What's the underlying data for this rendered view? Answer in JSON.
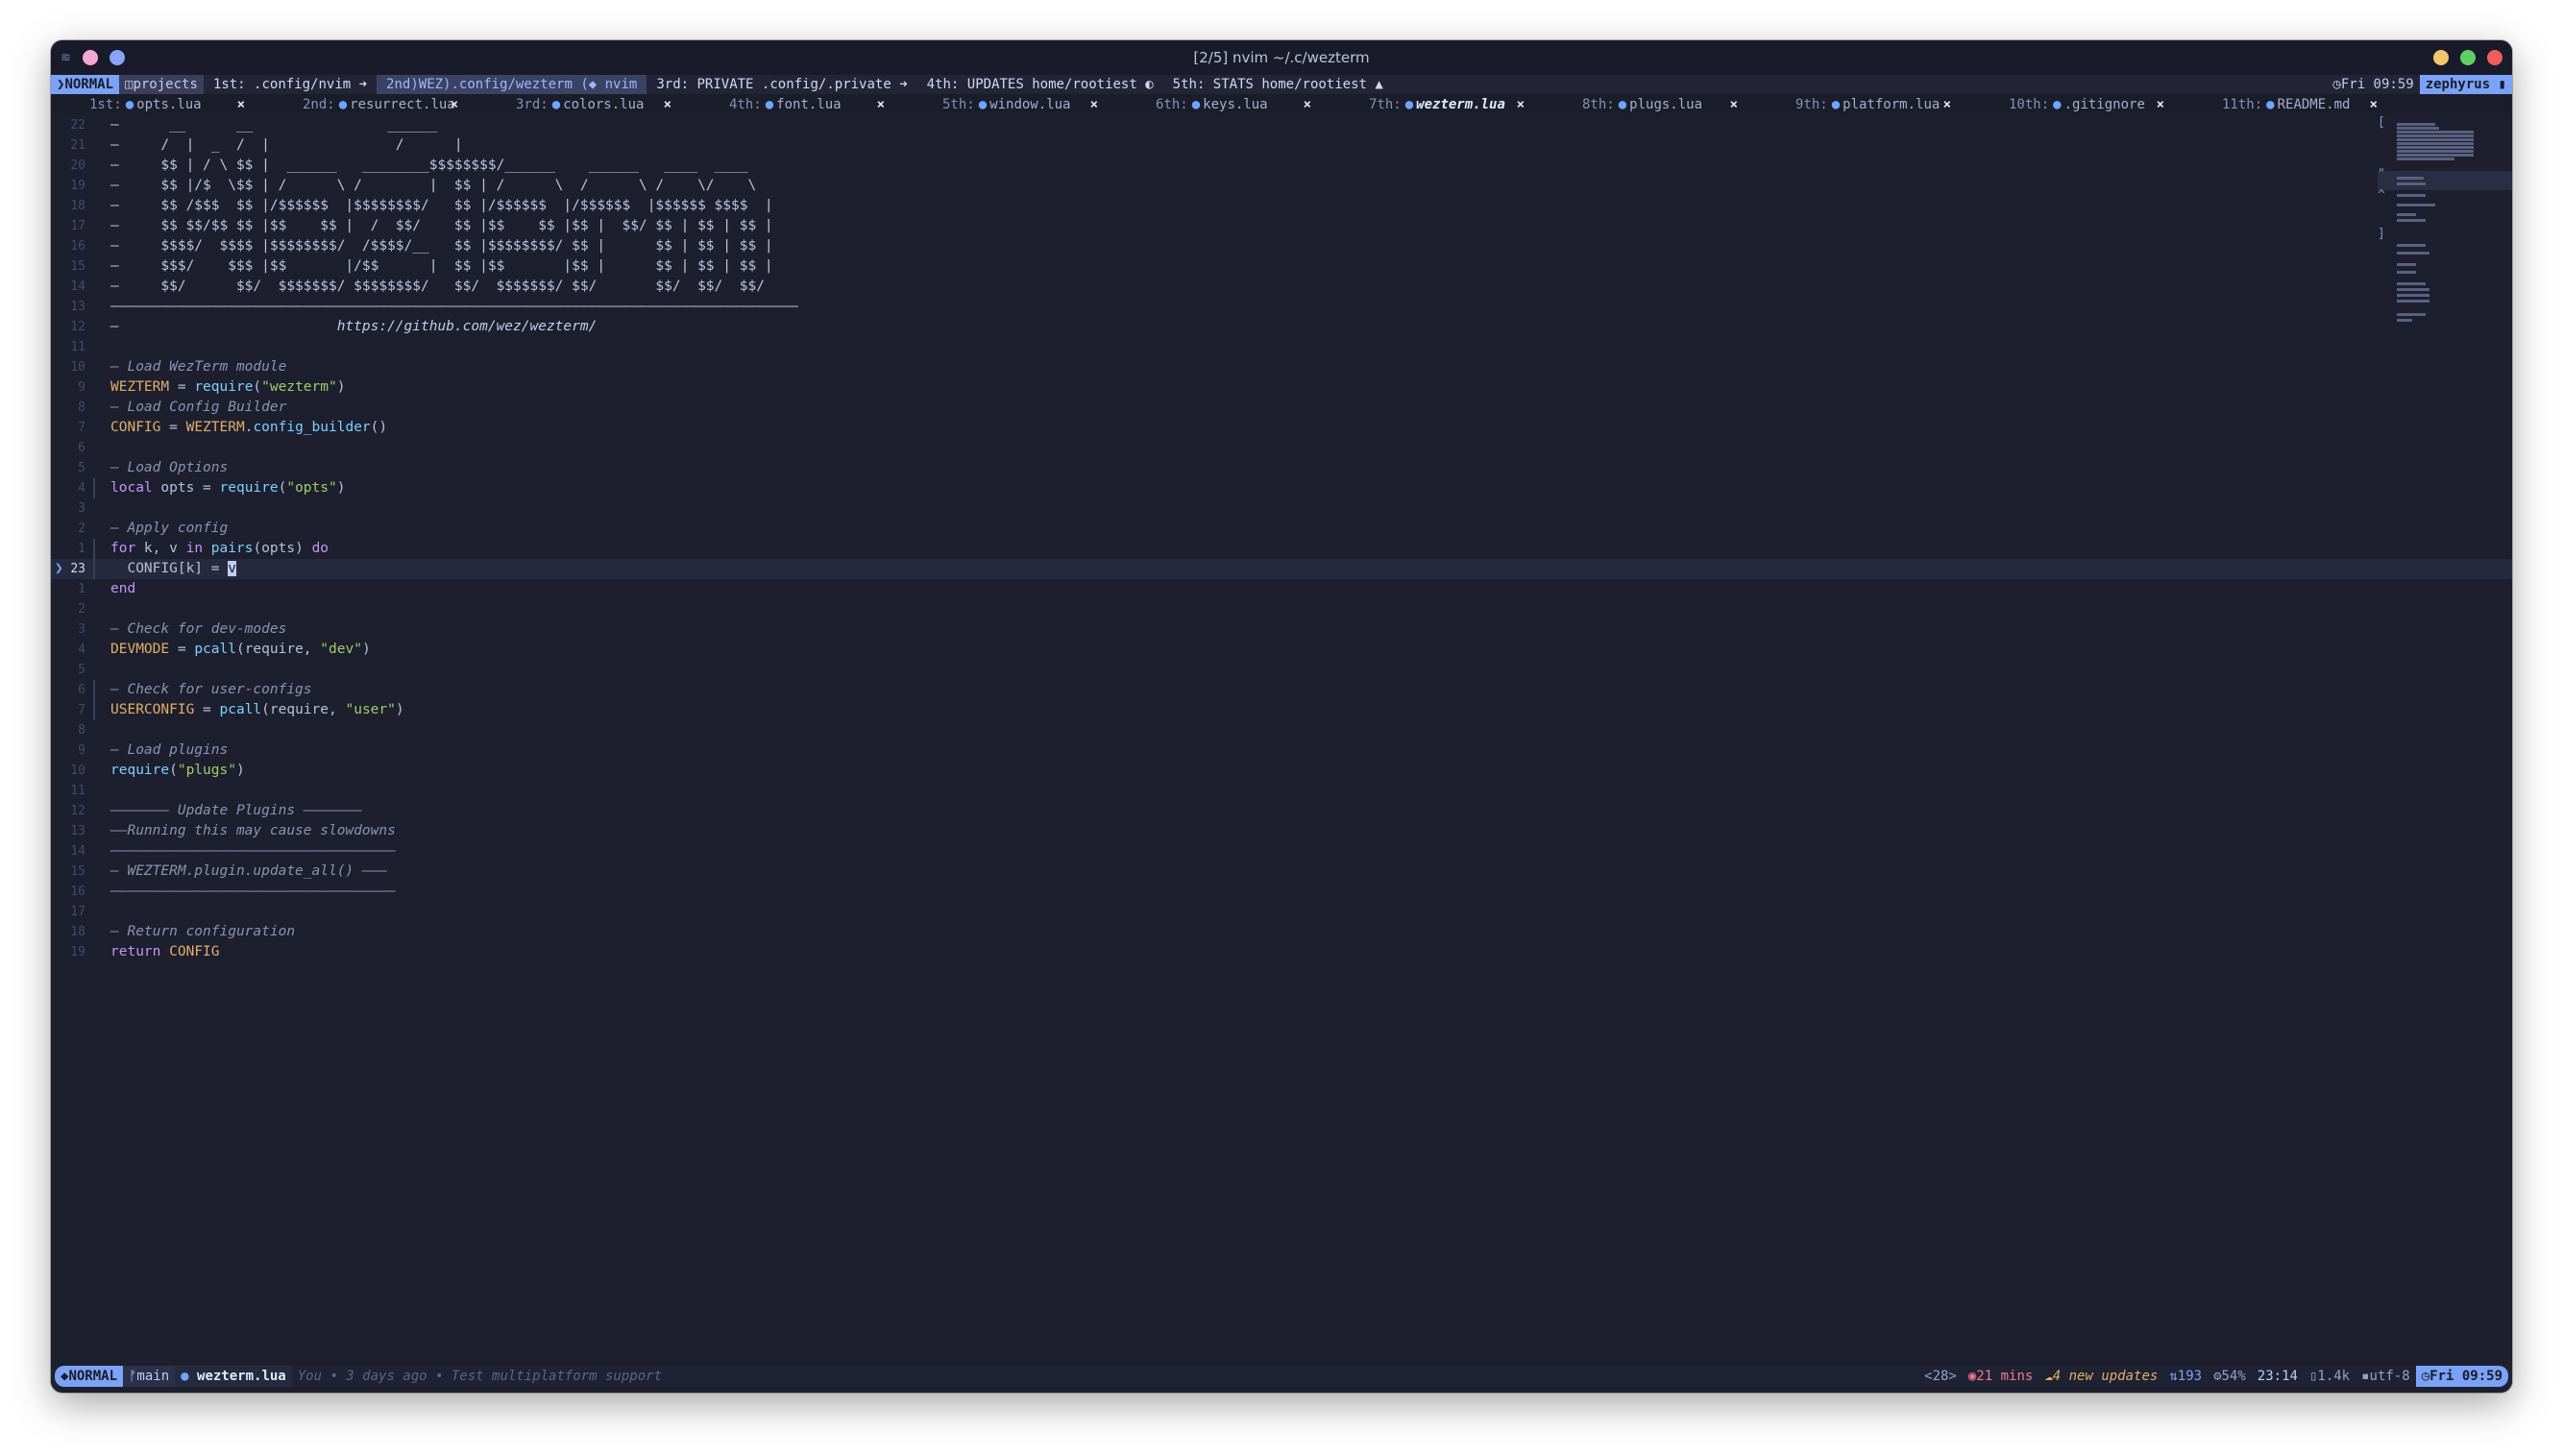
{
  "window": {
    "title": "[2/5] nvim ~/.c/wezterm",
    "left_icon": "≋",
    "traffic": {
      "yellow": "#f4c66b",
      "green": "#5fcf65",
      "red": "#ee5f5b",
      "pink": "#f4a7d3",
      "blue": "#8aa4f8"
    }
  },
  "wezbar": {
    "mode": "NORMAL",
    "project": "projects",
    "tabs": [
      {
        "label": "1st: .config/nvim ➜"
      },
      {
        "label": "2nd)WEZ).config/wezterm (◆ nvim"
      },
      {
        "label": "3rd: PRIVATE .config/.private ➜"
      },
      {
        "label": "4th: UPDATES home/rootiest ◐"
      },
      {
        "label": "5th: STATS home/rootiest ▲"
      }
    ],
    "clock": "Fri 09:59",
    "host": "zephyrus"
  },
  "buffers": [
    {
      "ord": "1st:",
      "name": "opts.lua",
      "close": "×"
    },
    {
      "ord": "2nd:",
      "name": "resurrect.lua",
      "close": "×"
    },
    {
      "ord": "3rd:",
      "name": "colors.lua",
      "close": "×"
    },
    {
      "ord": "4th:",
      "name": "font.lua",
      "close": "×"
    },
    {
      "ord": "5th:",
      "name": "window.lua",
      "close": "×"
    },
    {
      "ord": "6th:",
      "name": "keys.lua",
      "close": "×"
    },
    {
      "ord": "7th:",
      "name": "wezterm.lua",
      "close": "×",
      "active": true
    },
    {
      "ord": "8th:",
      "name": "plugs.lua",
      "close": "×"
    },
    {
      "ord": "9th:",
      "name": "platform.lua",
      "close": "×"
    },
    {
      "ord": "10th:",
      "name": ".gitignore",
      "close": "×"
    },
    {
      "ord": "11th:",
      "name": "README.md",
      "close": "×"
    }
  ],
  "editor": {
    "lines": [
      {
        "num": "22",
        "kind": "art",
        "text": "—      __      __                ______"
      },
      {
        "num": "21",
        "kind": "art",
        "text": "—     /  |  _  /  |               /      |"
      },
      {
        "num": "20",
        "kind": "art",
        "text": "—     $$ | / \\ $$ |  ______   ________$$$$$$$$/______    ______   ____  ____"
      },
      {
        "num": "19",
        "kind": "art",
        "text": "—     $$ |/$  \\$$ | /      \\ /        |  $$ | /      \\  /      \\ /    \\/    \\"
      },
      {
        "num": "18",
        "kind": "art",
        "text": "—     $$ /$$$  $$ |/$$$$$$  |$$$$$$$$/   $$ |/$$$$$$  |/$$$$$$  |$$$$$$ $$$$  |"
      },
      {
        "num": "17",
        "kind": "art",
        "text": "—     $$ $$/$$ $$ |$$    $$ |  /  $$/    $$ |$$    $$ |$$ |  $$/ $$ | $$ | $$ |"
      },
      {
        "num": "16",
        "kind": "art",
        "text": "—     $$$$/  $$$$ |$$$$$$$$/  /$$$$/__   $$ |$$$$$$$$/ $$ |      $$ | $$ | $$ |"
      },
      {
        "num": "15",
        "kind": "art",
        "text": "—     $$$/    $$$ |$$       |/$$      |  $$ |$$       |$$ |      $$ | $$ | $$ |"
      },
      {
        "num": "14",
        "kind": "art",
        "text": "—     $$/      $$/  $$$$$$$/ $$$$$$$$/   $$/  $$$$$$$/ $$/       $$/  $$/  $$/"
      },
      {
        "num": "13",
        "kind": "art",
        "text": "——————————————————————————————————————————————————————————————————————————————————"
      },
      {
        "num": "12",
        "kind": "url",
        "text": "—                          https://github.com/wez/wezterm/"
      },
      {
        "num": "11",
        "kind": "blank",
        "text": ""
      },
      {
        "num": "10",
        "kind": "comment",
        "text": "— Load WezTerm module"
      },
      {
        "num": "9",
        "kind": "code",
        "parts": [
          [
            "g",
            "WEZTERM"
          ],
          [
            "p",
            " = "
          ],
          [
            "f",
            "require"
          ],
          [
            "p",
            "("
          ],
          [
            "s",
            "\"wezterm\""
          ],
          [
            "p",
            ")"
          ]
        ]
      },
      {
        "num": "8",
        "kind": "comment",
        "text": "— Load Config Builder"
      },
      {
        "num": "7",
        "kind": "code",
        "parts": [
          [
            "g",
            "CONFIG"
          ],
          [
            "p",
            " = "
          ],
          [
            "g",
            "WEZTERM"
          ],
          [
            "p",
            "."
          ],
          [
            "f",
            "config_builder"
          ],
          [
            "p",
            "()"
          ]
        ]
      },
      {
        "num": "6",
        "kind": "blank",
        "text": ""
      },
      {
        "num": "5",
        "kind": "comment",
        "text": "— Load Options"
      },
      {
        "num": "4",
        "kind": "code",
        "bar": true,
        "parts": [
          [
            "k",
            "local"
          ],
          [
            "p",
            " opts = "
          ],
          [
            "f",
            "require"
          ],
          [
            "p",
            "("
          ],
          [
            "s",
            "\"opts\""
          ],
          [
            "p",
            ")"
          ]
        ]
      },
      {
        "num": "3",
        "kind": "blank",
        "text": ""
      },
      {
        "num": "2",
        "kind": "comment",
        "text": "— Apply config"
      },
      {
        "num": "1",
        "kind": "code",
        "bar": true,
        "parts": [
          [
            "k",
            "for"
          ],
          [
            "p",
            " k, v "
          ],
          [
            "k",
            "in"
          ],
          [
            "p",
            " "
          ],
          [
            "f",
            "pairs"
          ],
          [
            "p",
            "(opts) "
          ],
          [
            "k",
            "do"
          ]
        ]
      },
      {
        "num": "23",
        "kind": "cur",
        "parts": [
          [
            "p",
            "  CONFIG[k] = "
          ],
          [
            "c",
            "v"
          ]
        ]
      },
      {
        "num": "1",
        "kind": "code",
        "parts": [
          [
            "k",
            "end"
          ]
        ]
      },
      {
        "num": "2",
        "kind": "blank",
        "text": ""
      },
      {
        "num": "3",
        "kind": "comment",
        "text": "— Check for dev-modes"
      },
      {
        "num": "4",
        "kind": "code",
        "parts": [
          [
            "g",
            "DEVMODE"
          ],
          [
            "p",
            " = "
          ],
          [
            "f",
            "pcall"
          ],
          [
            "p",
            "(require, "
          ],
          [
            "s",
            "\"dev\""
          ],
          [
            "p",
            ")"
          ]
        ]
      },
      {
        "num": "5",
        "kind": "blank",
        "text": ""
      },
      {
        "num": "6",
        "kind": "comment",
        "bar": true,
        "text": "— Check for user-configs"
      },
      {
        "num": "7",
        "kind": "code",
        "bar": true,
        "parts": [
          [
            "g",
            "USERCONFIG"
          ],
          [
            "p",
            " = "
          ],
          [
            "f",
            "pcall"
          ],
          [
            "p",
            "(require, "
          ],
          [
            "s",
            "\"user\""
          ],
          [
            "p",
            ")"
          ]
        ]
      },
      {
        "num": "8",
        "kind": "blank",
        "text": ""
      },
      {
        "num": "9",
        "kind": "comment",
        "text": "— Load plugins"
      },
      {
        "num": "10",
        "kind": "code",
        "parts": [
          [
            "f",
            "require"
          ],
          [
            "p",
            "("
          ],
          [
            "s",
            "\"plugs\""
          ],
          [
            "p",
            ")"
          ]
        ]
      },
      {
        "num": "11",
        "kind": "blank",
        "text": ""
      },
      {
        "num": "12",
        "kind": "comment",
        "text": "——————— Update Plugins ———————"
      },
      {
        "num": "13",
        "kind": "comment",
        "text": "——Running this may cause slowdowns"
      },
      {
        "num": "14",
        "kind": "comment",
        "text": "——————————————————————————————————"
      },
      {
        "num": "15",
        "kind": "comment",
        "text": "— WEZTERM.plugin.update_all() ———"
      },
      {
        "num": "16",
        "kind": "comment",
        "text": "——————————————————————————————————"
      },
      {
        "num": "17",
        "kind": "blank",
        "text": ""
      },
      {
        "num": "18",
        "kind": "comment",
        "text": "— Return configuration"
      },
      {
        "num": "19",
        "kind": "code",
        "parts": [
          [
            "k",
            "return"
          ],
          [
            "p",
            " "
          ],
          [
            "g",
            "CONFIG"
          ]
        ]
      }
    ]
  },
  "status": {
    "mode": "NORMAL",
    "branch": "main",
    "file": "wezterm.lua",
    "blame": "You • 3 days ago • Test multiplatform support",
    "count": "<28>",
    "timer": "21 mins",
    "updates": "4 new updates",
    "network": "193",
    "cpu": "54%",
    "position": "23:14",
    "size": "1.4k",
    "encoding": "utf-8",
    "clock": "Fri 09:59"
  }
}
